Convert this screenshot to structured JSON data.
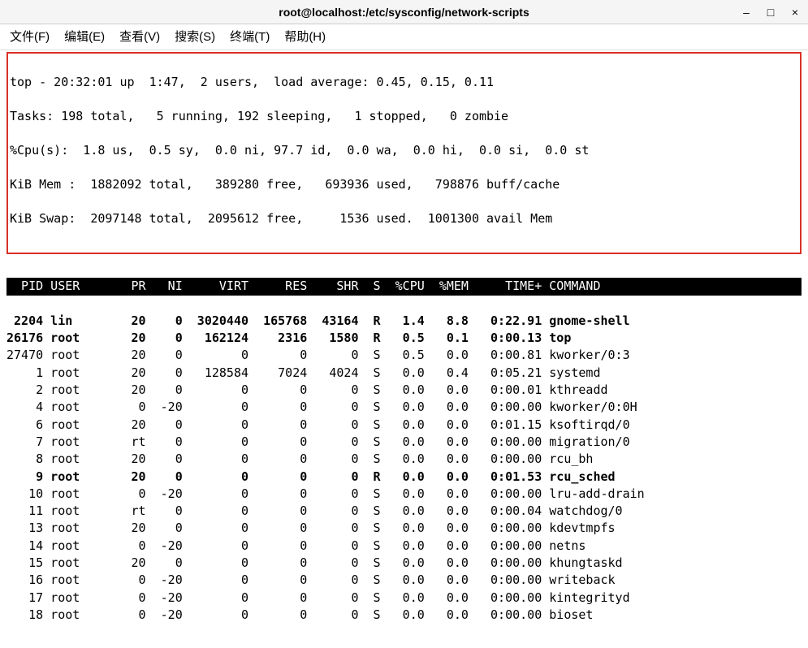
{
  "window": {
    "title": "root@localhost:/etc/sysconfig/network-scripts",
    "minimize_icon": "–",
    "maximize_icon": "□",
    "close_icon": "×"
  },
  "menu": {
    "file": "文件(F)",
    "edit": "编辑(E)",
    "view": "查看(V)",
    "search": "搜索(S)",
    "terminal": "终端(T)",
    "help": "帮助(H)"
  },
  "top_summary": {
    "line1": "top - 20:32:01 up  1:47,  2 users,  load average: 0.45, 0.15, 0.11",
    "line2": "Tasks: 198 total,   5 running, 192 sleeping,   1 stopped,   0 zombie",
    "line3": "%Cpu(s):  1.8 us,  0.5 sy,  0.0 ni, 97.7 id,  0.0 wa,  0.0 hi,  0.0 si,  0.0 st",
    "line4": "KiB Mem :  1882092 total,   389280 free,   693936 used,   798876 buff/cache",
    "line5": "KiB Swap:  2097148 total,  2095612 free,     1536 used.  1001300 avail Mem"
  },
  "columns": [
    "PID",
    "USER",
    "PR",
    "NI",
    "VIRT",
    "RES",
    "SHR",
    "S",
    "%CPU",
    "%MEM",
    "TIME+",
    "COMMAND"
  ],
  "processes": [
    {
      "pid": 2204,
      "user": "lin",
      "pr": "20",
      "ni": "0",
      "virt": "3020440",
      "res": "165768",
      "shr": "43164",
      "s": "R",
      "cpu": "1.4",
      "mem": "8.8",
      "time": "0:22.91",
      "cmd": "gnome-shell",
      "bold": true
    },
    {
      "pid": 26176,
      "user": "root",
      "pr": "20",
      "ni": "0",
      "virt": "162124",
      "res": "2316",
      "shr": "1580",
      "s": "R",
      "cpu": "0.5",
      "mem": "0.1",
      "time": "0:00.13",
      "cmd": "top",
      "bold": true
    },
    {
      "pid": 27470,
      "user": "root",
      "pr": "20",
      "ni": "0",
      "virt": "0",
      "res": "0",
      "shr": "0",
      "s": "S",
      "cpu": "0.5",
      "mem": "0.0",
      "time": "0:00.81",
      "cmd": "kworker/0:3",
      "bold": false
    },
    {
      "pid": 1,
      "user": "root",
      "pr": "20",
      "ni": "0",
      "virt": "128584",
      "res": "7024",
      "shr": "4024",
      "s": "S",
      "cpu": "0.0",
      "mem": "0.4",
      "time": "0:05.21",
      "cmd": "systemd",
      "bold": false
    },
    {
      "pid": 2,
      "user": "root",
      "pr": "20",
      "ni": "0",
      "virt": "0",
      "res": "0",
      "shr": "0",
      "s": "S",
      "cpu": "0.0",
      "mem": "0.0",
      "time": "0:00.01",
      "cmd": "kthreadd",
      "bold": false
    },
    {
      "pid": 4,
      "user": "root",
      "pr": "0",
      "ni": "-20",
      "virt": "0",
      "res": "0",
      "shr": "0",
      "s": "S",
      "cpu": "0.0",
      "mem": "0.0",
      "time": "0:00.00",
      "cmd": "kworker/0:0H",
      "bold": false
    },
    {
      "pid": 6,
      "user": "root",
      "pr": "20",
      "ni": "0",
      "virt": "0",
      "res": "0",
      "shr": "0",
      "s": "S",
      "cpu": "0.0",
      "mem": "0.0",
      "time": "0:01.15",
      "cmd": "ksoftirqd/0",
      "bold": false
    },
    {
      "pid": 7,
      "user": "root",
      "pr": "rt",
      "ni": "0",
      "virt": "0",
      "res": "0",
      "shr": "0",
      "s": "S",
      "cpu": "0.0",
      "mem": "0.0",
      "time": "0:00.00",
      "cmd": "migration/0",
      "bold": false
    },
    {
      "pid": 8,
      "user": "root",
      "pr": "20",
      "ni": "0",
      "virt": "0",
      "res": "0",
      "shr": "0",
      "s": "S",
      "cpu": "0.0",
      "mem": "0.0",
      "time": "0:00.00",
      "cmd": "rcu_bh",
      "bold": false
    },
    {
      "pid": 9,
      "user": "root",
      "pr": "20",
      "ni": "0",
      "virt": "0",
      "res": "0",
      "shr": "0",
      "s": "R",
      "cpu": "0.0",
      "mem": "0.0",
      "time": "0:01.53",
      "cmd": "rcu_sched",
      "bold": true
    },
    {
      "pid": 10,
      "user": "root",
      "pr": "0",
      "ni": "-20",
      "virt": "0",
      "res": "0",
      "shr": "0",
      "s": "S",
      "cpu": "0.0",
      "mem": "0.0",
      "time": "0:00.00",
      "cmd": "lru-add-drain",
      "bold": false
    },
    {
      "pid": 11,
      "user": "root",
      "pr": "rt",
      "ni": "0",
      "virt": "0",
      "res": "0",
      "shr": "0",
      "s": "S",
      "cpu": "0.0",
      "mem": "0.0",
      "time": "0:00.04",
      "cmd": "watchdog/0",
      "bold": false
    },
    {
      "pid": 13,
      "user": "root",
      "pr": "20",
      "ni": "0",
      "virt": "0",
      "res": "0",
      "shr": "0",
      "s": "S",
      "cpu": "0.0",
      "mem": "0.0",
      "time": "0:00.00",
      "cmd": "kdevtmpfs",
      "bold": false
    },
    {
      "pid": 14,
      "user": "root",
      "pr": "0",
      "ni": "-20",
      "virt": "0",
      "res": "0",
      "shr": "0",
      "s": "S",
      "cpu": "0.0",
      "mem": "0.0",
      "time": "0:00.00",
      "cmd": "netns",
      "bold": false
    },
    {
      "pid": 15,
      "user": "root",
      "pr": "20",
      "ni": "0",
      "virt": "0",
      "res": "0",
      "shr": "0",
      "s": "S",
      "cpu": "0.0",
      "mem": "0.0",
      "time": "0:00.00",
      "cmd": "khungtaskd",
      "bold": false
    },
    {
      "pid": 16,
      "user": "root",
      "pr": "0",
      "ni": "-20",
      "virt": "0",
      "res": "0",
      "shr": "0",
      "s": "S",
      "cpu": "0.0",
      "mem": "0.0",
      "time": "0:00.00",
      "cmd": "writeback",
      "bold": false
    },
    {
      "pid": 17,
      "user": "root",
      "pr": "0",
      "ni": "-20",
      "virt": "0",
      "res": "0",
      "shr": "0",
      "s": "S",
      "cpu": "0.0",
      "mem": "0.0",
      "time": "0:00.00",
      "cmd": "kintegrityd",
      "bold": false
    },
    {
      "pid": 18,
      "user": "root",
      "pr": "0",
      "ni": "-20",
      "virt": "0",
      "res": "0",
      "shr": "0",
      "s": "S",
      "cpu": "0.0",
      "mem": "0.0",
      "time": "0:00.00",
      "cmd": "bioset",
      "bold": false
    }
  ]
}
